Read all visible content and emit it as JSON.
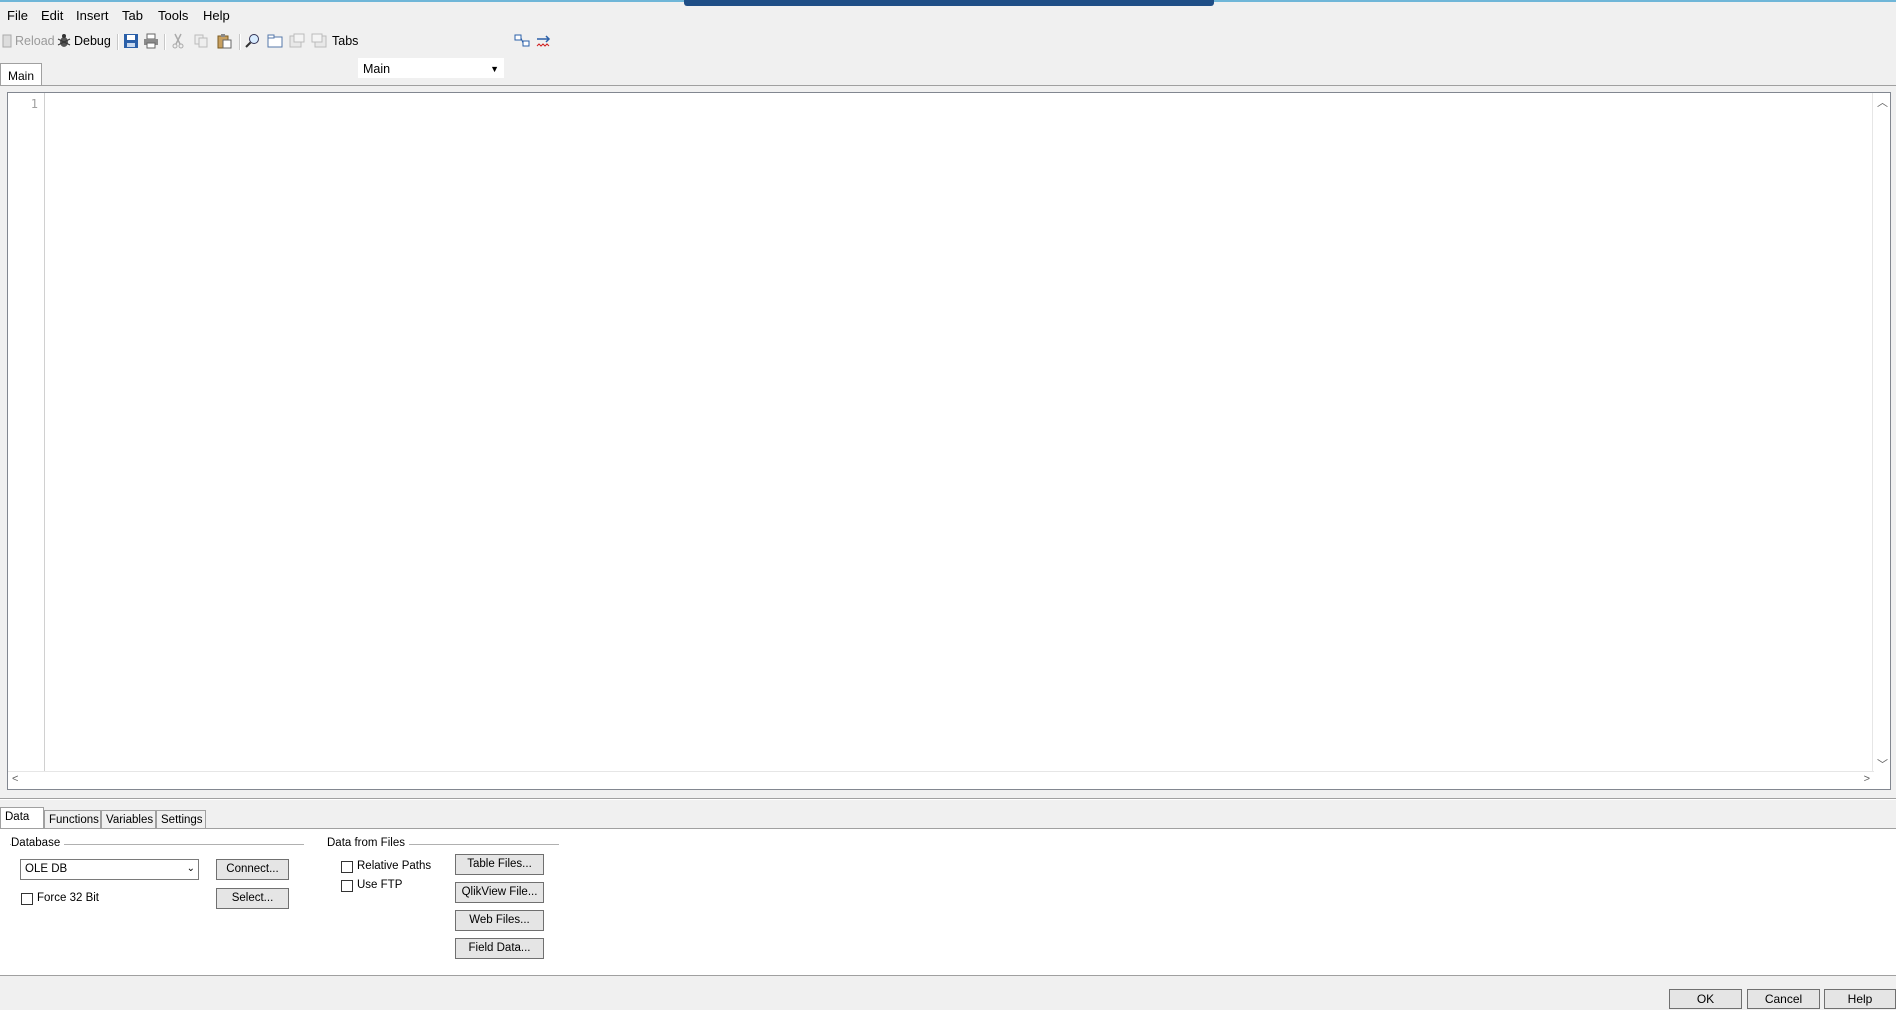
{
  "menu": [
    "File",
    "Edit",
    "Insert",
    "Tab",
    "Tools",
    "Help"
  ],
  "toolbar": {
    "reload_label": "Reload",
    "debug_label": "Debug",
    "tabs_label": "Tabs",
    "tabs_selected": "Main"
  },
  "script_tab": "Main",
  "editor": {
    "line_number": "1"
  },
  "panel_tabs": [
    "Data",
    "Functions",
    "Variables",
    "Settings"
  ],
  "database": {
    "group_title": "Database",
    "selected": "OLE DB",
    "connect_label": "Connect...",
    "select_label": "Select...",
    "force32_label": "Force 32 Bit"
  },
  "files": {
    "group_title": "Data from Files",
    "relative_paths_label": "Relative Paths",
    "use_ftp_label": "Use FTP",
    "table_files_label": "Table Files...",
    "qlikview_file_label": "QlikView File...",
    "web_files_label": "Web Files...",
    "field_data_label": "Field Data..."
  },
  "dialog": {
    "ok_label": "OK",
    "cancel_label": "Cancel",
    "help_label": "Help"
  }
}
